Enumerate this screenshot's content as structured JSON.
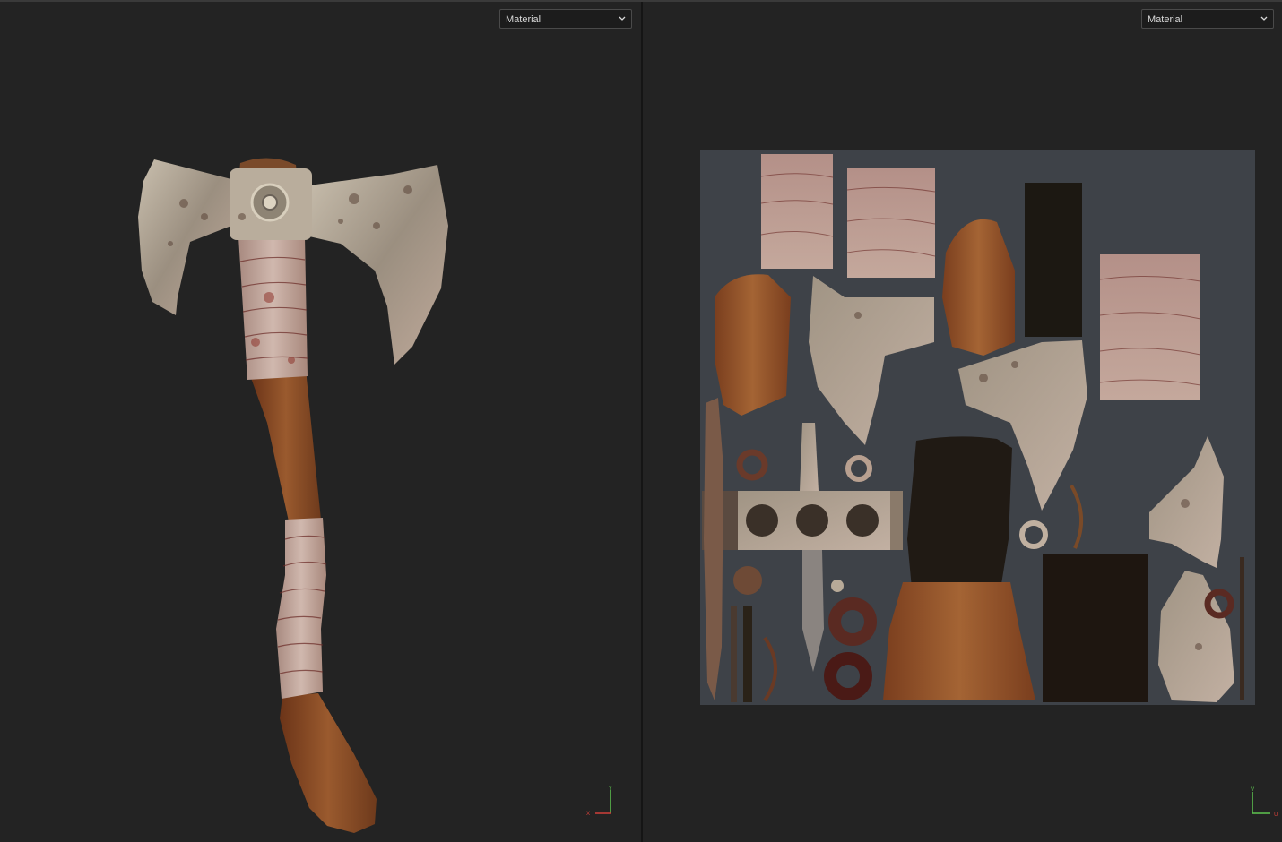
{
  "viewports": {
    "model_3d": {
      "shading_dropdown": {
        "value": "Material"
      },
      "axis_gizmo": {
        "x_label": "X",
        "y_label": "Y"
      }
    },
    "uv_editor": {
      "shading_dropdown": {
        "value": "Material"
      },
      "axis_gizmo": {
        "u_label": "U",
        "v_label": "V"
      }
    }
  },
  "icons": {
    "dropdown_arrow": "chevron-down-icon"
  },
  "colors": {
    "background": "#232323",
    "metal": "#a89c8e",
    "wood": "#8a4a24",
    "wrap": "#b89a8e",
    "axis_x": "#d0403a",
    "axis_y": "#5ec450"
  }
}
